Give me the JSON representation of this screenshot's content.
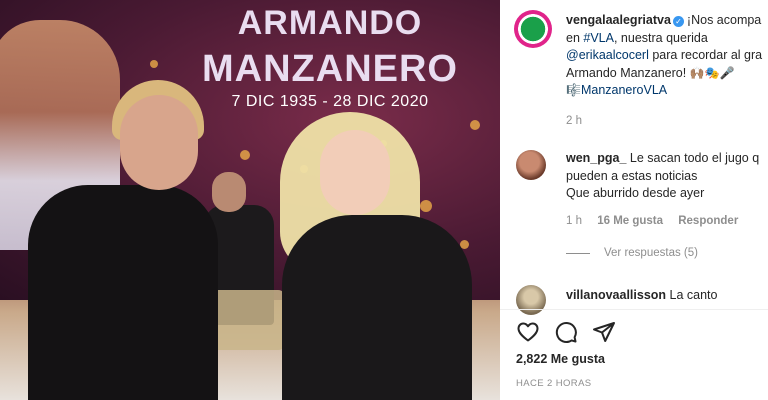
{
  "photo": {
    "tribute": {
      "line1": "ARMANDO",
      "line2": "MANZANERO",
      "dates": "7 DIC 1935 - 28 DIC 2020"
    }
  },
  "post": {
    "author": "vengalaalegriatva",
    "verified_icon": "verified-badge-icon",
    "caption_line1": "¡Nos acompa",
    "caption_line2_prefix": "en ",
    "caption_hashtag": "#VLA",
    "caption_line2_suffix": ", nuestra querida",
    "caption_mention": "@erikaalcocerl",
    "caption_line3_suffix": " para recordar al gra",
    "caption_line4": "Armando Manzanero! ",
    "caption_line4_emojis": "🙌🏽🎭🎤",
    "caption_line5_emoji": "🎼",
    "caption_hashtag2": "ManzaneroVLA",
    "age": "2 h",
    "likes": "2,822 Me gusta",
    "posted_at": "HACE 2 HORAS"
  },
  "comments": [
    {
      "user": "wen_pga_",
      "text_line1": "Le sacan todo el jugo q",
      "text_line2": "pueden a estas noticias",
      "text_line3": "Que aburrido desde ayer",
      "age": "1 h",
      "likes": "16 Me gusta",
      "reply_label": "Responder",
      "view_replies": "Ver respuestas (5)"
    },
    {
      "user": "villanovaallisson",
      "text_line1": "La canto"
    }
  ],
  "actions": {
    "like_icon": "heart-icon",
    "comment_icon": "comment-icon",
    "share_icon": "share-icon"
  }
}
